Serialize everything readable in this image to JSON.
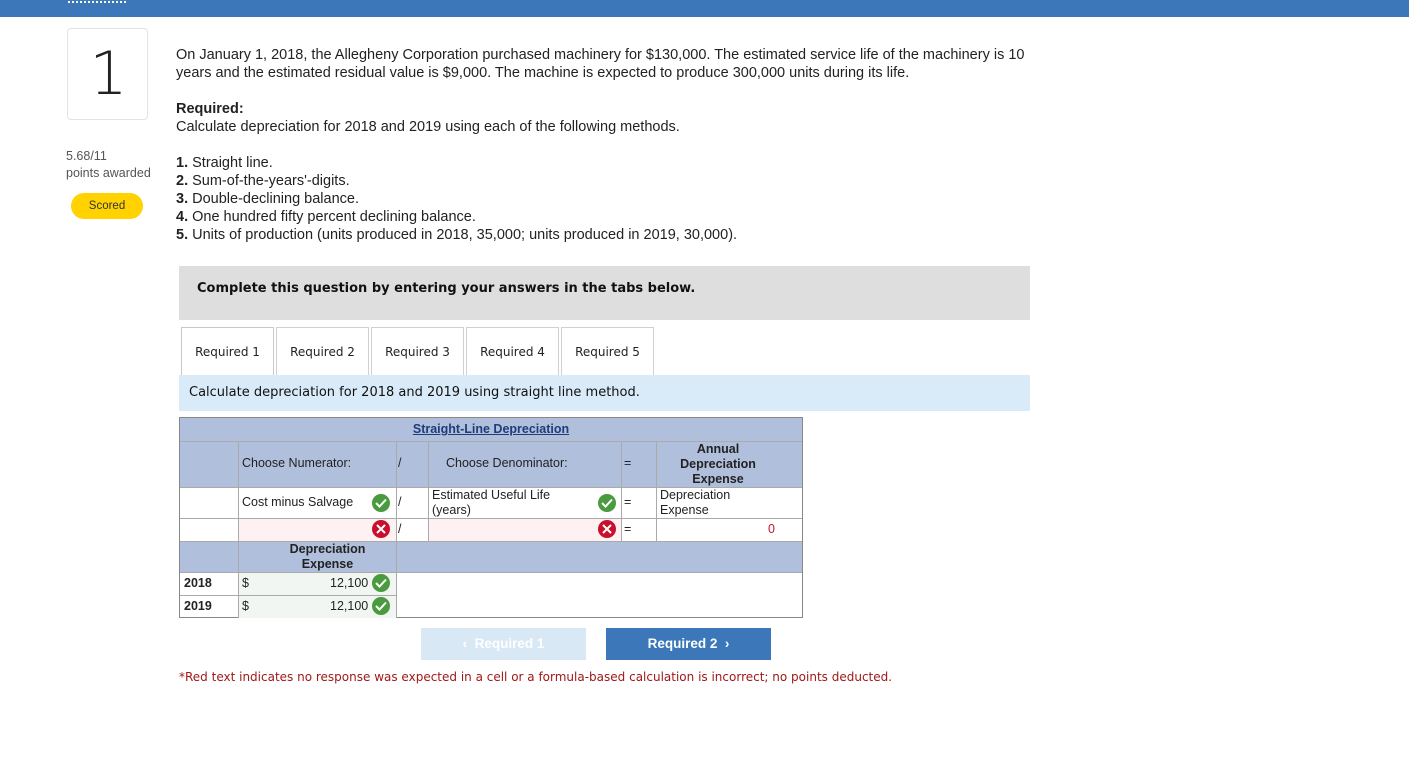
{
  "question": {
    "number": "1",
    "points": "5.68/11",
    "points_label": "points awarded",
    "status_badge": "Scored",
    "paragraph_line1": "On January 1, 2018, the Allegheny Corporation purchased machinery for $130,000. The estimated service life of the machinery is 10",
    "paragraph_line2": "years and the estimated residual value is $9,000. The machine is expected to produce 300,000 units during its life.",
    "required_heading": "Required:",
    "required_text": "Calculate depreciation for 2018 and 2019 using each of the following methods.",
    "methods": [
      {
        "num": "1.",
        "text": " Straight line."
      },
      {
        "num": "2.",
        "text": " Sum-of-the-years'-digits."
      },
      {
        "num": "3.",
        "text": " Double-declining balance."
      },
      {
        "num": "4.",
        "text": " One hundred fifty percent declining balance."
      },
      {
        "num": "5.",
        "text": " Units of production (units produced in 2018, 35,000; units produced in 2019, 30,000)."
      }
    ]
  },
  "instructions": "Complete this question by entering your answers in the tabs below.",
  "tabs": [
    {
      "label": "Required 1"
    },
    {
      "label": "Required 2"
    },
    {
      "label": "Required 3"
    },
    {
      "label": "Required 4"
    },
    {
      "label": "Required 5"
    }
  ],
  "tab_description": "Calculate depreciation for 2018 and 2019 using straight line method.",
  "table": {
    "title": "Straight-Line Depreciation",
    "header_numerator": "Choose Numerator:",
    "header_slash": "/",
    "header_denominator": "Choose Denominator:",
    "header_equals": "=",
    "header_result": "Annual Depreciation Expense",
    "row1": {
      "numerator": "Cost minus Salvage",
      "slash": "/",
      "denominator": "Estimated Useful Life (years)",
      "equals": "=",
      "result": "Depreciation Expense"
    },
    "row2": {
      "slash": "/",
      "equals": "=",
      "result": "0"
    },
    "dep_header": "Depreciation Expense",
    "years": [
      {
        "year": "2018",
        "currency": "$",
        "amount": "12,100"
      },
      {
        "year": "2019",
        "currency": "$",
        "amount": "12,100"
      }
    ]
  },
  "nav": {
    "prev_label": "Required 1",
    "next_label": "Required 2"
  },
  "note": "*Red text indicates no response was expected in a cell or a formula-based calculation is incorrect; no points deducted.",
  "colors": {
    "topbar": "#3b77b9",
    "badge": "#ffd200",
    "check": "#4a9a3f",
    "error": "#c8102e",
    "header_fill": "#b0bfdb"
  }
}
